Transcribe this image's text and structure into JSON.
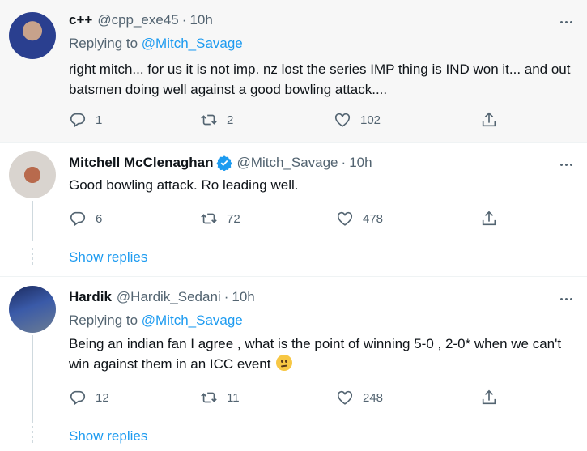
{
  "tweets": [
    {
      "name": "c++",
      "handle": "@cpp_exe45",
      "sep": "·",
      "time": "10h",
      "replying_prefix": "Replying to ",
      "replying_to": "@Mitch_Savage",
      "text": "right mitch... for us it is not imp. nz lost the series IMP thing is IND won it... and out batsmen doing well against a good bowling attack....",
      "replies": "1",
      "retweets": "2",
      "likes": "102"
    },
    {
      "name": "Mitchell McClenaghan",
      "handle": "@Mitch_Savage",
      "sep": "·",
      "time": "10h",
      "verified": true,
      "text": "Good bowling attack. Ro leading well.",
      "replies": "6",
      "retweets": "72",
      "likes": "478",
      "show_replies": "Show replies"
    },
    {
      "name": "Hardik",
      "handle": "@Hardik_Sedani",
      "sep": "·",
      "time": "10h",
      "replying_prefix": "Replying to ",
      "replying_to": "@Mitch_Savage",
      "text": "Being an indian fan I agree , what is the point of winning 5-0 , 2-0* when we can't win against them in an ICC event",
      "emoji": "confused-face",
      "replies": "12",
      "retweets": "11",
      "likes": "248",
      "show_replies": "Show replies"
    }
  ],
  "colors": {
    "link": "#1d9bf0",
    "secondary": "#536471",
    "highlight_bg": "#f7f7f7",
    "verified": "#1d9bf0"
  }
}
